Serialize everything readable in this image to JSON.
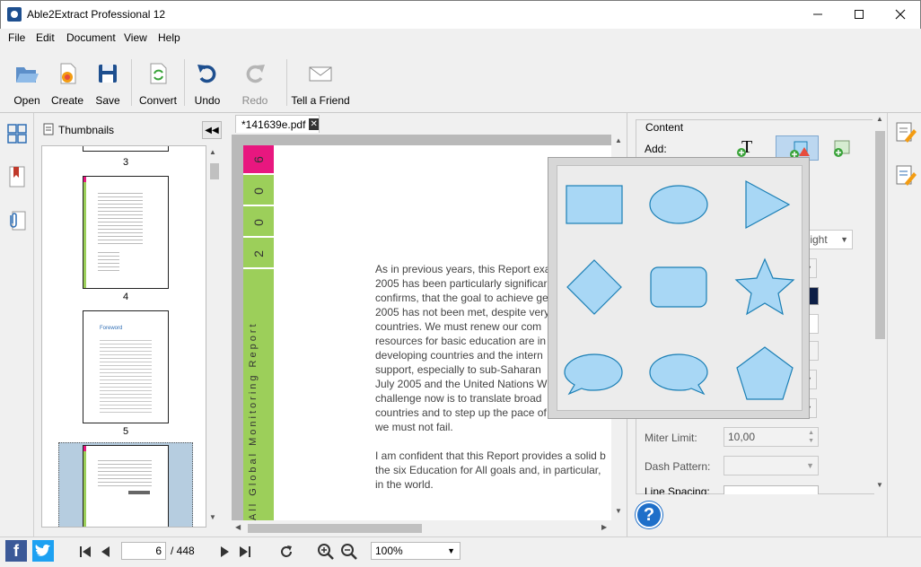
{
  "window": {
    "title": "Able2Extract Professional 12"
  },
  "menu": [
    "File",
    "Edit",
    "Document",
    "View",
    "Help"
  ],
  "toolbar": {
    "open": "Open",
    "create": "Create",
    "save": "Save",
    "convert": "Convert",
    "undo": "Undo",
    "redo": "Redo",
    "tell_friend": "Tell a Friend"
  },
  "thumbnails": {
    "label": "Thumbnails",
    "pages": [
      "3",
      "4",
      "5"
    ],
    "page5_heading": "Foreword"
  },
  "document": {
    "tab_name": "*141639e.pdf",
    "band": [
      "6",
      "0",
      "0",
      "2"
    ],
    "vertical_title": "All Global Monitoring Report",
    "para1": [
      "As in previous years, this Report exa",
      "2005 has been particularly significar",
      "confirms, that the goal to achieve ge",
      "2005 has not been met, despite very",
      "countries. We must renew our com",
      "resources for basic education are in",
      "developing countries and the intern",
      "support, especially to sub-Saharan",
      "July 2005 and the United Nations W",
      "challenge now is to translate broad",
      "countries and to step up the pace of",
      "we must not fail."
    ],
    "para2": [
      "I am confident that this Report provides a solid b",
      "the six Education for All goals and, in particular,",
      "in the world."
    ]
  },
  "properties": {
    "section": "Content",
    "add_label": "Add:",
    "font_style_value": "e-Light",
    "miter_label": "Miter Limit:",
    "miter_value": "10,00",
    "dash_label": "Dash Pattern:",
    "line_spacing_label": "Line Spacing:"
  },
  "status": {
    "current_page": "6",
    "total_pages": "/ 448",
    "zoom": "100%"
  },
  "colors": {
    "accent_blue": "#1e4f8f",
    "shape_fill": "#a8d7f5",
    "shape_stroke": "#1b7fb5",
    "band_green": "#9ccf5a",
    "band_pink": "#e8177f"
  }
}
